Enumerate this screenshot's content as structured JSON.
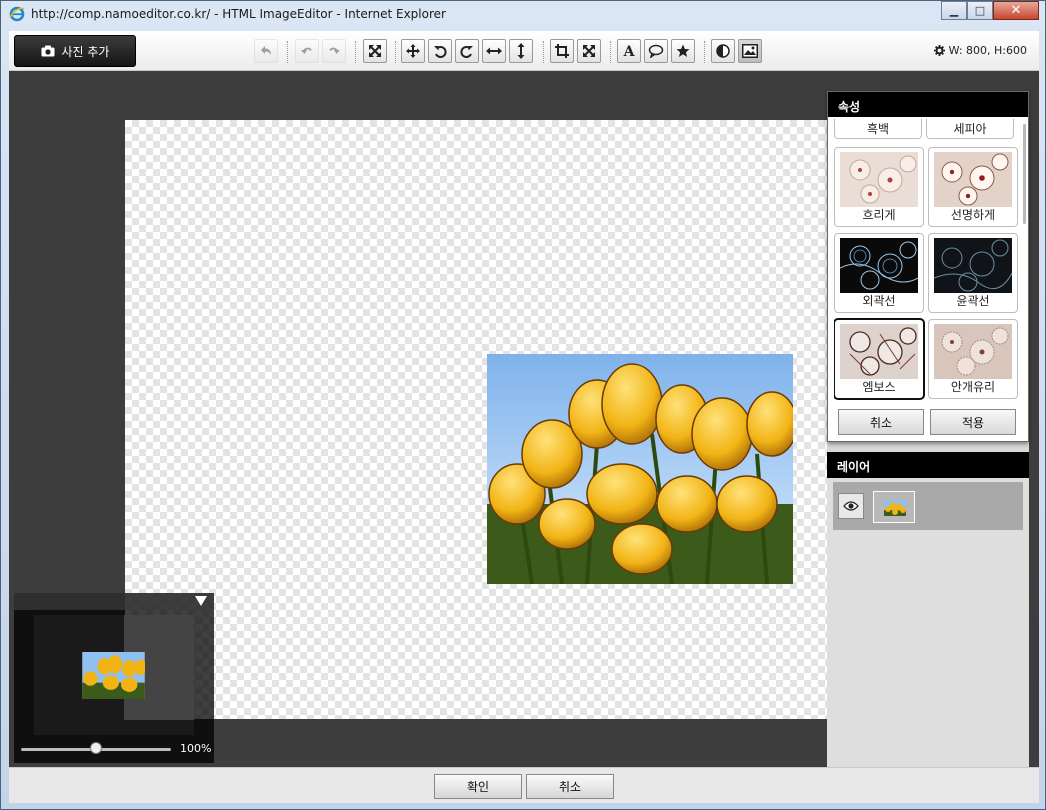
{
  "window": {
    "title": "http://comp.namoeditor.co.kr/ - HTML ImageEditor - Internet Explorer",
    "min_label": "▁",
    "max_label": "□",
    "close_label": "✕"
  },
  "toolbar": {
    "add_photo_label": "사진 추가",
    "size_info": "W: 800, H:600",
    "icons": [
      "undo-all",
      "undo",
      "redo",
      "fit",
      "move",
      "rotate-left",
      "rotate-right",
      "flip-horizontal",
      "flip-vertical",
      "crop",
      "resize",
      "text",
      "speech-bubble",
      "star",
      "contrast",
      "image"
    ]
  },
  "navigator": {
    "zoom": "100%",
    "zoom_level": 0.5
  },
  "properties": {
    "title": "속성",
    "top_effects": [
      "흑백",
      "세피아"
    ],
    "effects": [
      {
        "label": "흐리게",
        "style": "blur"
      },
      {
        "label": "선명하게",
        "style": "sharpen"
      },
      {
        "label": "외곽선",
        "style": "edge"
      },
      {
        "label": "윤곽선",
        "style": "contour"
      },
      {
        "label": "엠보스",
        "style": "emboss",
        "selected": true
      },
      {
        "label": "안개유리",
        "style": "frosted"
      }
    ],
    "cancel_label": "취소",
    "apply_label": "적용"
  },
  "layers": {
    "title": "레이어"
  },
  "footer": {
    "ok_label": "확인",
    "cancel_label": "취소"
  },
  "colors": {
    "workspace_bg": "#3d3d3d",
    "panel_header": "#000000",
    "selection": "#111111"
  }
}
